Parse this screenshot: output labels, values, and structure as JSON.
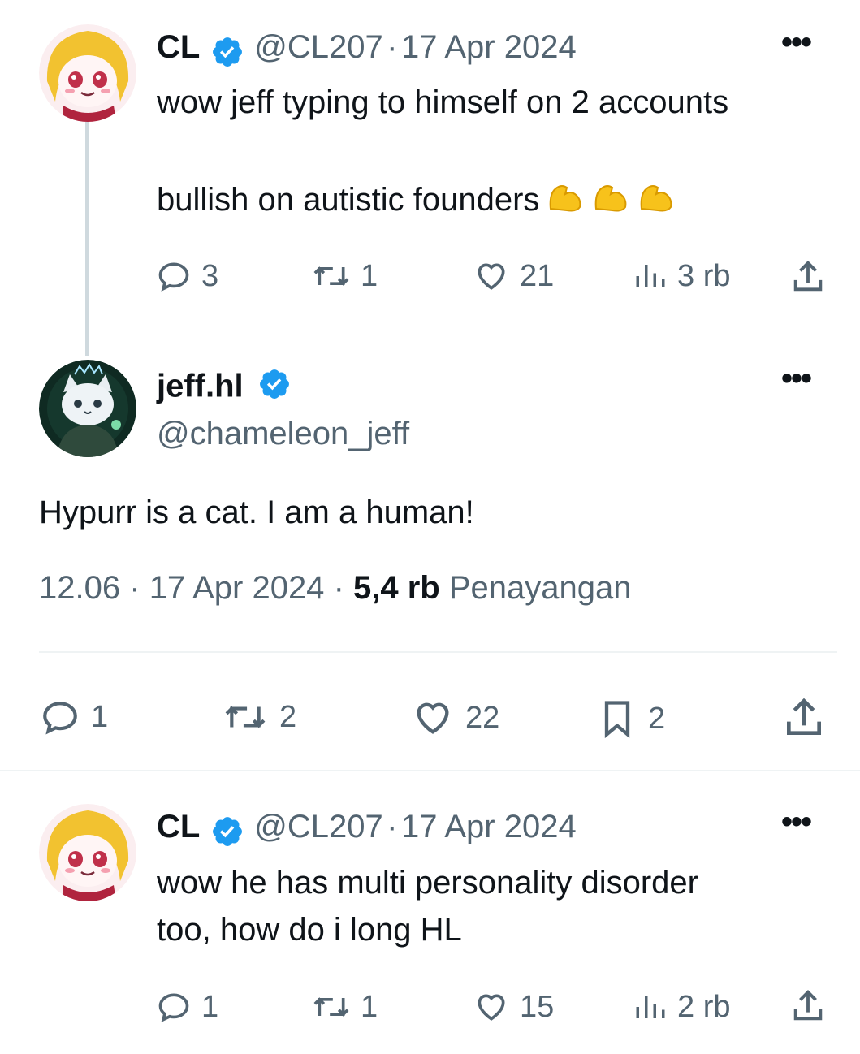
{
  "tweet1": {
    "name": "CL",
    "handle": "@CL207",
    "date": "17 Apr 2024",
    "sep": "·",
    "line1": "wow jeff typing to himself on 2 accounts",
    "line2": "bullish on autistic founders",
    "emoji": [
      "flexed-biceps",
      "flexed-biceps",
      "flexed-biceps"
    ],
    "replies": "3",
    "reposts": "1",
    "likes": "21",
    "views": "3 rb"
  },
  "main": {
    "name": "jeff.hl",
    "handle": "@chameleon_jeff",
    "text": "Hypurr is a cat. I am a human!",
    "time": "12.06",
    "sep1": "·",
    "date": "17 Apr 2024",
    "sep2": "·",
    "views_count": "5,4 rb",
    "views_label": "Penayangan",
    "replies": "1",
    "reposts": "2",
    "likes": "22",
    "bookmarks": "2"
  },
  "tweet2": {
    "name": "CL",
    "handle": "@CL207",
    "date": "17 Apr 2024",
    "sep": "·",
    "line1": "wow he has multi personality disorder",
    "line2": "too, how do i long HL",
    "replies": "1",
    "reposts": "1",
    "likes": "15",
    "views": "2 rb"
  },
  "more_glyph": "•••",
  "colors": {
    "verified": "#1d9bf0",
    "muted": "#536471",
    "text": "#0f1419",
    "divider": "#eff3f4",
    "thread": "#cfd9de"
  }
}
